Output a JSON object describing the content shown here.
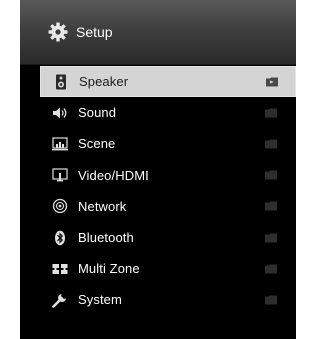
{
  "header": {
    "title": "Setup",
    "icon": "gear-icon"
  },
  "menu": {
    "items": [
      {
        "label": "Speaker",
        "icon": "speaker-icon",
        "selected": true
      },
      {
        "label": "Sound",
        "icon": "sound-icon",
        "selected": false
      },
      {
        "label": "Scene",
        "icon": "scene-icon",
        "selected": false
      },
      {
        "label": "Video/HDMI",
        "icon": "video-hdmi-icon",
        "selected": false
      },
      {
        "label": "Network",
        "icon": "network-icon",
        "selected": false
      },
      {
        "label": "Bluetooth",
        "icon": "bluetooth-icon",
        "selected": false
      },
      {
        "label": "Multi Zone",
        "icon": "multi-zone-icon",
        "selected": false
      },
      {
        "label": "System",
        "icon": "system-wrench-icon",
        "selected": false
      }
    ]
  },
  "colors": {
    "background": "#000000",
    "selected_row": "#d4d4d4",
    "text": "#ffffff",
    "selected_text": "#1a1a1a",
    "folder_selected": "#4a4a4a",
    "folder_normal": "#2e2e2e"
  }
}
